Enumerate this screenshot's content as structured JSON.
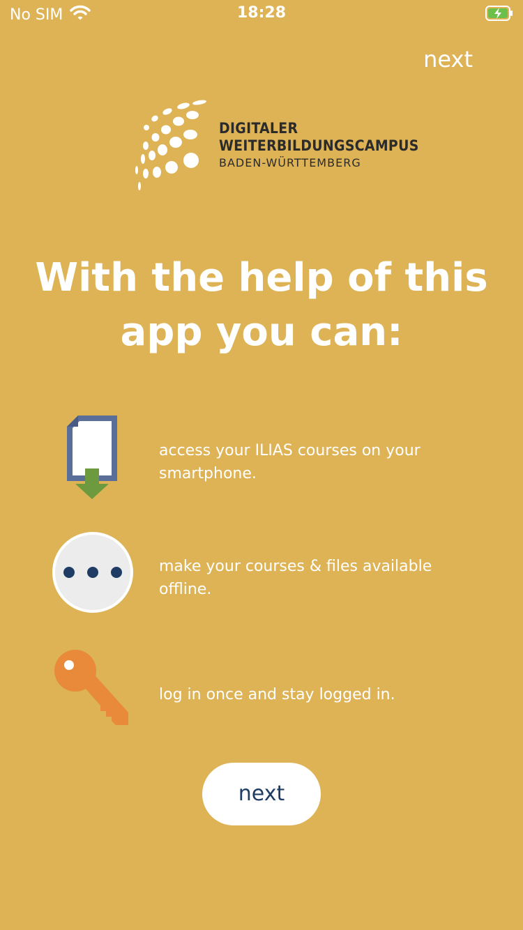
{
  "status_bar": {
    "carrier": "No SIM",
    "time": "18:28",
    "icons": [
      "wifi-icon",
      "battery-charging-icon"
    ]
  },
  "header": {
    "next_label": "next"
  },
  "logo": {
    "line1": "DIGITALER",
    "line2": "WEITERBILDUNGSCAMPUS",
    "line3": "BADEN-WÜRTTEMBERG"
  },
  "headline": "With the help of this app you can:",
  "features": [
    {
      "icon": "file-download-icon",
      "text": "access your ILIAS courses on your smartphone."
    },
    {
      "icon": "more-dots-icon",
      "text": "make your courses & files available offline."
    },
    {
      "icon": "key-icon",
      "text": "log in once and stay logged in."
    }
  ],
  "cta": {
    "label": "next"
  },
  "colors": {
    "background": "#DEB355",
    "text": "#FFFFFF",
    "button_text": "#1E3C64",
    "doc_icon_blue": "#5A6E9A",
    "arrow_green": "#6D9A3E",
    "key_orange": "#E98A3B"
  }
}
